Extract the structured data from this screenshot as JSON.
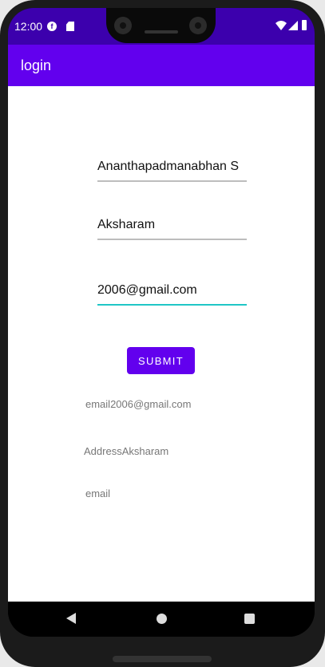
{
  "status_bar": {
    "time": "12:00",
    "icons": [
      "f-app-icon",
      "sd-card-icon",
      "wifi-icon",
      "signal-icon",
      "battery-icon"
    ]
  },
  "app_bar": {
    "title": "login"
  },
  "form": {
    "name_value": "Ananthapadmanabhan S",
    "address_value": "Aksharam",
    "email_value": "2006@gmail.com",
    "submit_label": "SUBMIT"
  },
  "output": {
    "line1": "email2006@gmail.com",
    "line2": "AddressAksharam",
    "line3": "email"
  },
  "colors": {
    "status_bar": "#3c00ad",
    "app_bar": "#6200ee",
    "focus_underline": "#1fc6c6"
  },
  "nav_bar": {
    "icons": [
      "back-icon",
      "home-icon",
      "recent-apps-icon"
    ]
  }
}
